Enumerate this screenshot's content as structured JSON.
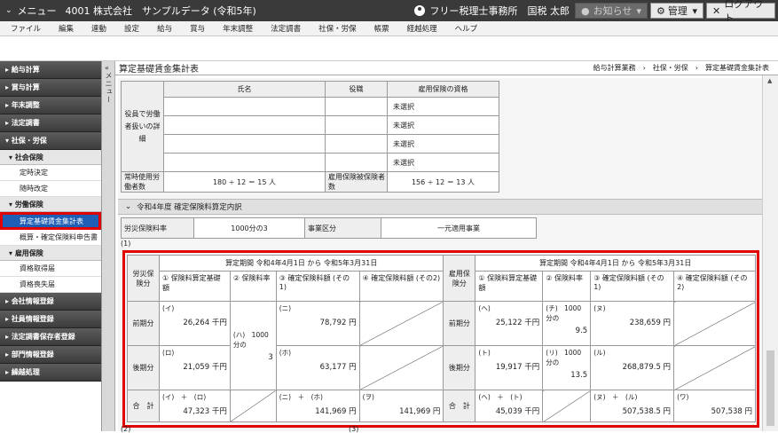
{
  "topbar": {
    "menu_label": "メニュー",
    "company": "4001 株式会社　サンプルデータ (令和5年)",
    "office": "フリー税理士事務所　国税 太郎",
    "notice_label": "お知らせ",
    "manage_label": "管理",
    "logout_label": "ログアウト"
  },
  "menubar": [
    "ファイル",
    "編集",
    "連動",
    "設定",
    "給与",
    "賞与",
    "年末調整",
    "法定調書",
    "社保・労保",
    "帳票",
    "経越処理",
    "ヘルプ"
  ],
  "sidebar": {
    "item_payroll": "給与計算",
    "item_bonus": "賞与計算",
    "item_yearend": "年末調整",
    "item_legal": "法定調書",
    "item_social": "社保・労保",
    "sub_social_ins": "社会保険",
    "leaf_teiji": "定時決定",
    "leaf_zuiji": "随時改定",
    "sub_labor_ins": "労働保険",
    "leaf_sanntei": "算定基礎賃金集計表",
    "leaf_gaisan": "概算・確定保険料申告書",
    "sub_employ_ins": "雇用保険",
    "leaf_shutoku": "資格取得届",
    "leaf_soshitsu": "資格喪失届",
    "item_company": "会社情報登録",
    "item_employee": "社員情報登録",
    "item_payer": "法定調書保存者登録",
    "item_dept": "部門情報登録",
    "item_carry": "繰越処理",
    "vtab_label": "メニュー"
  },
  "page": {
    "title": "算定基礎賃金集計表",
    "breadcrumb": "給与計算業務　›　社保・労保　›　算定基礎賃金集計表"
  },
  "officers": {
    "row_label": "役員で労働者扱いの詳細",
    "col_name": "氏名",
    "col_position": "役職",
    "col_employ": "雇用保険の資格",
    "employ_values": [
      "未選択",
      "未選択",
      "未選択",
      "未選択"
    ]
  },
  "workers": {
    "label_regular": "常時使用労働者数",
    "regular_value": "180 ÷ 12 ＝ 15 人",
    "label_employ": "雇用保険被保険者数",
    "employ_value": "156 ÷ 12 ＝ 13 人"
  },
  "section": {
    "heading": "令和4年度 確定保険料算定内訳"
  },
  "rate": {
    "label": "労災保険料率",
    "value": "1000分の3",
    "label_kubun": "事業区分",
    "kubun_value": "一元適用事業",
    "note1": "(1)",
    "note2": "(2)",
    "note3": "(3)"
  },
  "calc": {
    "rousai_label": "労災保険分",
    "koyou_label": "雇用保険分",
    "period_rousai": "算定期間 令和4年4月1日 から 令和5年3月31日",
    "period_koyou": "算定期間 令和4年4月1日 から 令和5年3月31日",
    "h1": "① 保険料算定基礎額",
    "h2": "② 保険料率",
    "h3": "③ 確定保険料額 (その1)",
    "h4": "④ 確定保険料額 (その2)",
    "row_first": "前期分",
    "row_second": "後期分",
    "row_total": "合　計",
    "i_label": "(イ)",
    "i_value": "26,264 千円",
    "ha_label": "(ハ)　1000分の",
    "ha_value": "3",
    "ni_label": "(ニ)",
    "ni_value": "78,792 円",
    "ro_label": "(ロ)",
    "ro_value": "21,059 千円",
    "ho_label": "(ホ)",
    "ho_value": "63,177 円",
    "ir_label": "(イ)　＋　(ロ)",
    "ir_value": "47,323 千円",
    "nh_label": "(ニ)　＋　(ホ)",
    "nh_value": "141,969 円",
    "wo_label": "(ヲ)",
    "wo_value": "141,969 円",
    "he_label": "(ヘ)",
    "he_value": "25,122 千円",
    "to_label": "(ト)",
    "to_value": "19,917 千円",
    "ht_label": "(ヘ)　＋　(ト)",
    "ht_value": "45,039 千円",
    "chi_label": "(チ)　1000分の",
    "chi_value": "9.5",
    "ri_label": "(リ)　1000分の",
    "ri_value": "13.5",
    "nu_label": "(ヌ)",
    "nu_value": "238,659 円",
    "ru_label": "(ル)",
    "ru_value": "268,879.5 円",
    "nr_label": "(ヌ)　＋　(ル)",
    "nr_value": "507,538.5 円",
    "tsu_label": "(ワ)",
    "tsu_value": "507,538 円"
  }
}
